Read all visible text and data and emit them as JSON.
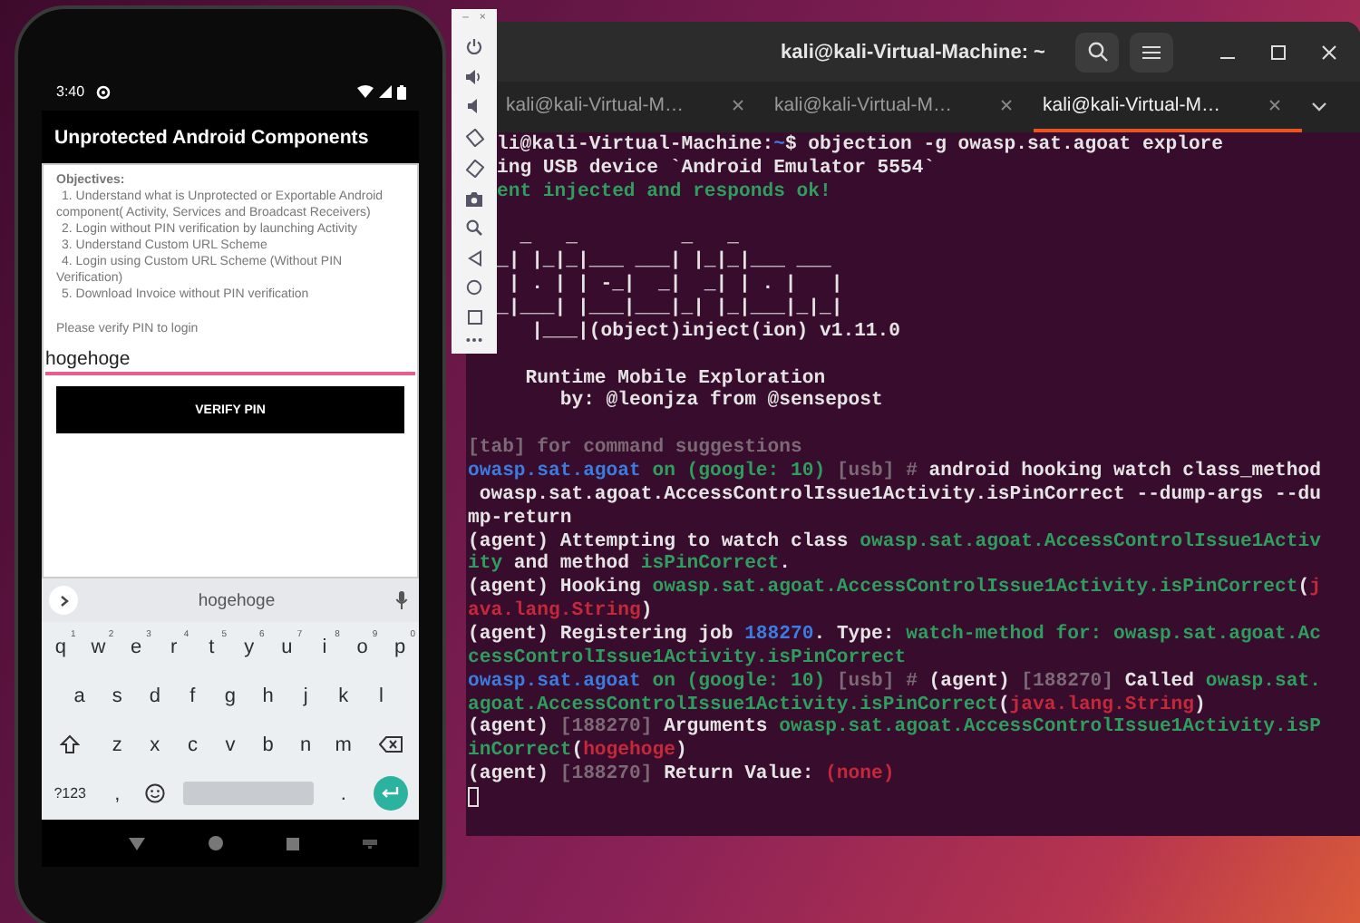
{
  "phone": {
    "status_bar": {
      "time": "3:40"
    },
    "app_bar": {
      "title": "Unprotected Android Components"
    },
    "content": {
      "heading": "Objectives:",
      "objectives": [
        "1. Understand what is Unprotected or Exportable Android component( Activity, Services and Broadcast Receivers)",
        "2. Login without PIN verification by launching Activity",
        "3. Understand Custom URL Scheme",
        "4. Login using Custom URL Scheme (Without PIN Verification)",
        "5. Download Invoice without PIN verification"
      ],
      "prompt": "Please verify PIN to login",
      "pin_field": {
        "value": "hogehoge"
      },
      "button": "VERIFY PIN"
    },
    "keyboard": {
      "suggestion": "hogehoge",
      "rows": [
        {
          "keys": [
            {
              "kind": "char",
              "label": "q",
              "hint": "1"
            },
            {
              "kind": "char",
              "label": "w",
              "hint": "2"
            },
            {
              "kind": "char",
              "label": "e",
              "hint": "3"
            },
            {
              "kind": "char",
              "label": "r",
              "hint": "4"
            },
            {
              "kind": "char",
              "label": "t",
              "hint": "5"
            },
            {
              "kind": "char",
              "label": "y",
              "hint": "6"
            },
            {
              "kind": "char",
              "label": "u",
              "hint": "7"
            },
            {
              "kind": "char",
              "label": "i",
              "hint": "8"
            },
            {
              "kind": "char",
              "label": "o",
              "hint": "9"
            },
            {
              "kind": "char",
              "label": "p",
              "hint": "0"
            }
          ]
        },
        {
          "keys": [
            {
              "kind": "char",
              "label": "a"
            },
            {
              "kind": "char",
              "label": "s"
            },
            {
              "kind": "char",
              "label": "d"
            },
            {
              "kind": "char",
              "label": "f"
            },
            {
              "kind": "char",
              "label": "g"
            },
            {
              "kind": "char",
              "label": "h"
            },
            {
              "kind": "char",
              "label": "j"
            },
            {
              "kind": "char",
              "label": "k"
            },
            {
              "kind": "char",
              "label": "l"
            }
          ]
        },
        {
          "keys": [
            {
              "kind": "shift"
            },
            {
              "kind": "char",
              "label": "z"
            },
            {
              "kind": "char",
              "label": "x"
            },
            {
              "kind": "char",
              "label": "c"
            },
            {
              "kind": "char",
              "label": "v"
            },
            {
              "kind": "char",
              "label": "b"
            },
            {
              "kind": "char",
              "label": "n"
            },
            {
              "kind": "char",
              "label": "m"
            },
            {
              "kind": "backspace"
            }
          ]
        },
        {
          "keys": [
            {
              "kind": "symbols",
              "label": "?123"
            },
            {
              "kind": "char",
              "label": ","
            },
            {
              "kind": "emoji"
            },
            {
              "kind": "space"
            },
            {
              "kind": "char",
              "label": "."
            },
            {
              "kind": "enter"
            }
          ]
        }
      ]
    }
  },
  "emulator_toolbar": {
    "minimize": "–",
    "close": "×"
  },
  "terminal": {
    "title": "kali@kali-Virtual-Machine: ~",
    "tabs": [
      {
        "label": "kali@kali-Virtual-M…",
        "selected": false
      },
      {
        "label": "kali@kali-Virtual-M…",
        "selected": false
      },
      {
        "label": "kali@kali-Virtual-M…",
        "selected": true
      }
    ],
    "lines": [
      {
        "kind": "text",
        "segments": [
          {
            "kind": "plain",
            "text": "li@kali-Virtual-Machine:"
          },
          {
            "kind": "blue",
            "text": "~"
          },
          {
            "kind": "plain",
            "text": "$ objection -g owasp.sat.agoat explore"
          }
        ]
      },
      {
        "kind": "text",
        "segments": [
          {
            "kind": "plain",
            "text": "ing USB device `Android Emulator 5554`"
          }
        ]
      },
      {
        "kind": "text",
        "segments": [
          {
            "kind": "green",
            "text": "ent injected and responds ok!"
          }
        ]
      },
      {
        "kind": "blank"
      },
      {
        "kind": "text",
        "segments": [
          {
            "kind": "plain",
            "text": "  _   _         _   _"
          }
        ]
      },
      {
        "kind": "text",
        "segments": [
          {
            "kind": "plain",
            "text": "_| |_|_|___ ___| |_|_|___ ___"
          }
        ]
      },
      {
        "kind": "text",
        "segments": [
          {
            "kind": "plain",
            "text": " | . | | -_|  _|  _| | . |   |"
          }
        ]
      },
      {
        "kind": "text",
        "segments": [
          {
            "kind": "plain",
            "text": "_|___| |___|___|_| |_|___|_|_|"
          }
        ]
      },
      {
        "kind": "text",
        "segments": [
          {
            "kind": "plain",
            "text": "   |___|(object)inject(ion) v1.11.0"
          }
        ]
      },
      {
        "kind": "blank"
      },
      {
        "kind": "text",
        "segments": [
          {
            "kind": "plain",
            "text": "     Runtime Mobile Exploration"
          }
        ]
      },
      {
        "kind": "text",
        "segments": [
          {
            "kind": "plain",
            "text": "        by: @leonjza from @sensepost"
          }
        ]
      },
      {
        "kind": "blank"
      },
      {
        "kind": "text",
        "segments": [
          {
            "kind": "dim",
            "text": "[tab] for command suggestions"
          }
        ]
      },
      {
        "kind": "text",
        "segments": [
          {
            "kind": "blue",
            "text": "owasp.sat.agoat"
          },
          {
            "kind": "green",
            "text": " on (google: 10) "
          },
          {
            "kind": "dim",
            "text": "[usb] # "
          },
          {
            "kind": "plain",
            "text": "android hooking watch class_method"
          }
        ]
      },
      {
        "kind": "text",
        "segments": [
          {
            "kind": "plain",
            "text": " owasp.sat.agoat.AccessControlIssue1Activity.isPinCorrect --dump-args --du"
          }
        ]
      },
      {
        "kind": "text",
        "segments": [
          {
            "kind": "plain",
            "text": "mp-return"
          }
        ]
      },
      {
        "kind": "text",
        "segments": [
          {
            "kind": "plain",
            "text": "(agent) Attempting to watch class "
          },
          {
            "kind": "green",
            "text": "owasp.sat.agoat.AccessControlIssue1Activ"
          }
        ]
      },
      {
        "kind": "text",
        "segments": [
          {
            "kind": "green",
            "text": "ity"
          },
          {
            "kind": "plain",
            "text": " and method "
          },
          {
            "kind": "green",
            "text": "isPinCorrect"
          },
          {
            "kind": "plain",
            "text": "."
          }
        ]
      },
      {
        "kind": "text",
        "segments": [
          {
            "kind": "plain",
            "text": "(agent) Hooking "
          },
          {
            "kind": "green",
            "text": "owasp.sat.agoat.AccessControlIssue1Activity.isPinCorrect"
          },
          {
            "kind": "plain",
            "text": "("
          },
          {
            "kind": "red",
            "text": "j"
          }
        ]
      },
      {
        "kind": "text",
        "segments": [
          {
            "kind": "red",
            "text": "ava.lang.String"
          },
          {
            "kind": "plain",
            "text": ")"
          }
        ]
      },
      {
        "kind": "text",
        "segments": [
          {
            "kind": "plain",
            "text": "(agent) Registering job "
          },
          {
            "kind": "blue",
            "text": "188270"
          },
          {
            "kind": "plain",
            "text": ". Type: "
          },
          {
            "kind": "green",
            "text": "watch-method for: owasp.sat.agoat.Ac"
          }
        ]
      },
      {
        "kind": "text",
        "segments": [
          {
            "kind": "green",
            "text": "cessControlIssue1Activity.isPinCorrect"
          }
        ]
      },
      {
        "kind": "text",
        "segments": [
          {
            "kind": "blue",
            "text": "owasp.sat.agoat"
          },
          {
            "kind": "green",
            "text": " on (google: 10) "
          },
          {
            "kind": "dim",
            "text": "[usb] # "
          },
          {
            "kind": "plain",
            "text": "(agent) "
          },
          {
            "kind": "dim",
            "text": "[188270]"
          },
          {
            "kind": "plain",
            "text": " Called "
          },
          {
            "kind": "green",
            "text": "owasp.sat."
          }
        ]
      },
      {
        "kind": "text",
        "segments": [
          {
            "kind": "green",
            "text": "agoat.AccessControlIssue1Activity.isPinCorrect"
          },
          {
            "kind": "plain",
            "text": "("
          },
          {
            "kind": "red",
            "text": "java.lang.String"
          },
          {
            "kind": "plain",
            "text": ")"
          }
        ]
      },
      {
        "kind": "text",
        "segments": [
          {
            "kind": "plain",
            "text": "(agent) "
          },
          {
            "kind": "dim",
            "text": "[188270]"
          },
          {
            "kind": "plain",
            "text": " Arguments "
          },
          {
            "kind": "green",
            "text": "owasp.sat.agoat.AccessControlIssue1Activity.isP"
          }
        ]
      },
      {
        "kind": "text",
        "segments": [
          {
            "kind": "green",
            "text": "inCorrect"
          },
          {
            "kind": "plain",
            "text": "("
          },
          {
            "kind": "red",
            "text": "hogehoge"
          },
          {
            "kind": "plain",
            "text": ")"
          }
        ]
      },
      {
        "kind": "text",
        "segments": [
          {
            "kind": "plain",
            "text": "(agent) "
          },
          {
            "kind": "dim",
            "text": "[188270]"
          },
          {
            "kind": "plain",
            "text": " Return Value: "
          },
          {
            "kind": "red",
            "text": "(none)"
          }
        ]
      },
      {
        "kind": "cursor"
      }
    ]
  }
}
